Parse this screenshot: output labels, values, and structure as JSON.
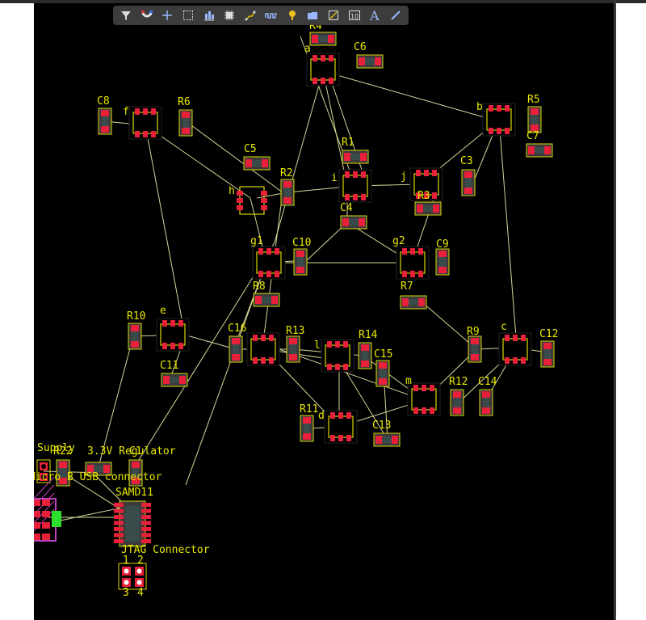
{
  "toolbar": {
    "tools": [
      {
        "name": "filter-icon",
        "label": "Filter"
      },
      {
        "name": "magnet-icon",
        "label": "Snap"
      },
      {
        "name": "crosshair-icon",
        "label": "Move"
      },
      {
        "name": "select-rect-icon",
        "label": "Select"
      },
      {
        "name": "align-icon",
        "label": "Align"
      },
      {
        "name": "chip-icon",
        "label": "Component"
      },
      {
        "name": "route-icon",
        "label": "Route"
      },
      {
        "name": "meander-icon",
        "label": "Meander"
      },
      {
        "name": "pin-icon",
        "label": "Pad"
      },
      {
        "name": "folder-icon",
        "label": "Region"
      },
      {
        "name": "image-icon",
        "label": "Graphic"
      },
      {
        "name": "counter-icon",
        "label": "10"
      },
      {
        "name": "text-icon",
        "label": "A"
      },
      {
        "name": "line-icon",
        "label": "Line"
      }
    ]
  },
  "labels": {
    "R4": "R4",
    "a": "a",
    "C6": "C6",
    "C8": "C8",
    "f": "f",
    "R6": "R6",
    "b": "b",
    "R5": "R5",
    "C7": "C7",
    "C5": "C5",
    "R1": "R1",
    "R2": "R2",
    "i": "i",
    "j": "j",
    "C3": "C3",
    "h": "h",
    "R3": "R3",
    "C4": "C4",
    "g1": "g1",
    "C10": "C10",
    "g2": "g2",
    "C9": "C9",
    "R8": "R8",
    "R7": "R7",
    "R10": "R10",
    "e": "e",
    "C16": "C16",
    "R13": "R13",
    "R14": "R14",
    "l": "l",
    "C15": "C15",
    "R9": "R9",
    "c": "c",
    "C12": "C12",
    "C11": "C11",
    "m": "m",
    "R12": "R12",
    "C14": "C14",
    "R11": "R11",
    "d": "d",
    "C13": "C13",
    "supply": "Supply",
    "r22": "R22",
    "regulator": "3.3V Regulator",
    "c1": "C1",
    "usb": "Micro B USB connector",
    "samd": "SAMD11",
    "jtag": "JTAG Connector",
    "pin1": "1",
    "pin2": "2",
    "pin3": "3",
    "pin4": "4"
  },
  "colors": {
    "canvas": "#000000",
    "pad": "#e8203a",
    "silk": "#d8d800",
    "body": "#3a3a3a",
    "ratsnest": "#d7d79a",
    "label": "#e8e800",
    "usb_outline": "#c040c0",
    "usb_pad": "#2ee02e"
  }
}
